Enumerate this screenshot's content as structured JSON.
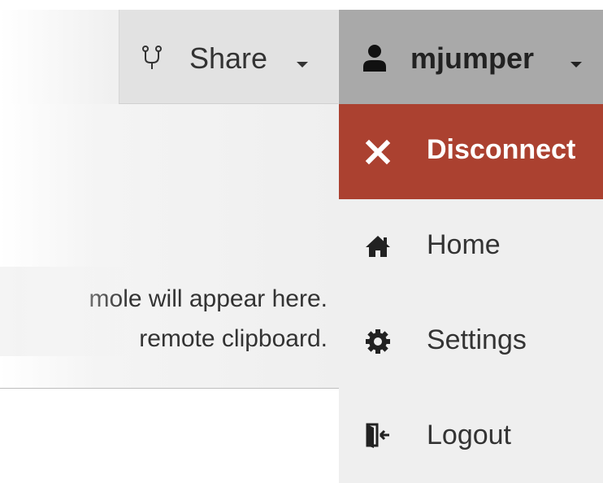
{
  "header": {
    "share_label": "Share",
    "user_label": "mjumper"
  },
  "clipboard": {
    "line1": "Text copied/cut within Guacamole will appear here.",
    "line2": "Changes to the text below will affect the remote clipboard.",
    "visible_line1": "mole will appear here.",
    "visible_line2": "remote clipboard."
  },
  "user_menu": {
    "items": [
      {
        "label": "Disconnect",
        "icon": "close-icon"
      },
      {
        "label": "Home",
        "icon": "home-icon"
      },
      {
        "label": "Settings",
        "icon": "gear-icon"
      },
      {
        "label": "Logout",
        "icon": "logout-icon"
      }
    ]
  },
  "colors": {
    "user_menu_bg": "#a9a9a9",
    "disconnect_bg": "#ab4130",
    "dropdown_bg": "#efefef"
  }
}
